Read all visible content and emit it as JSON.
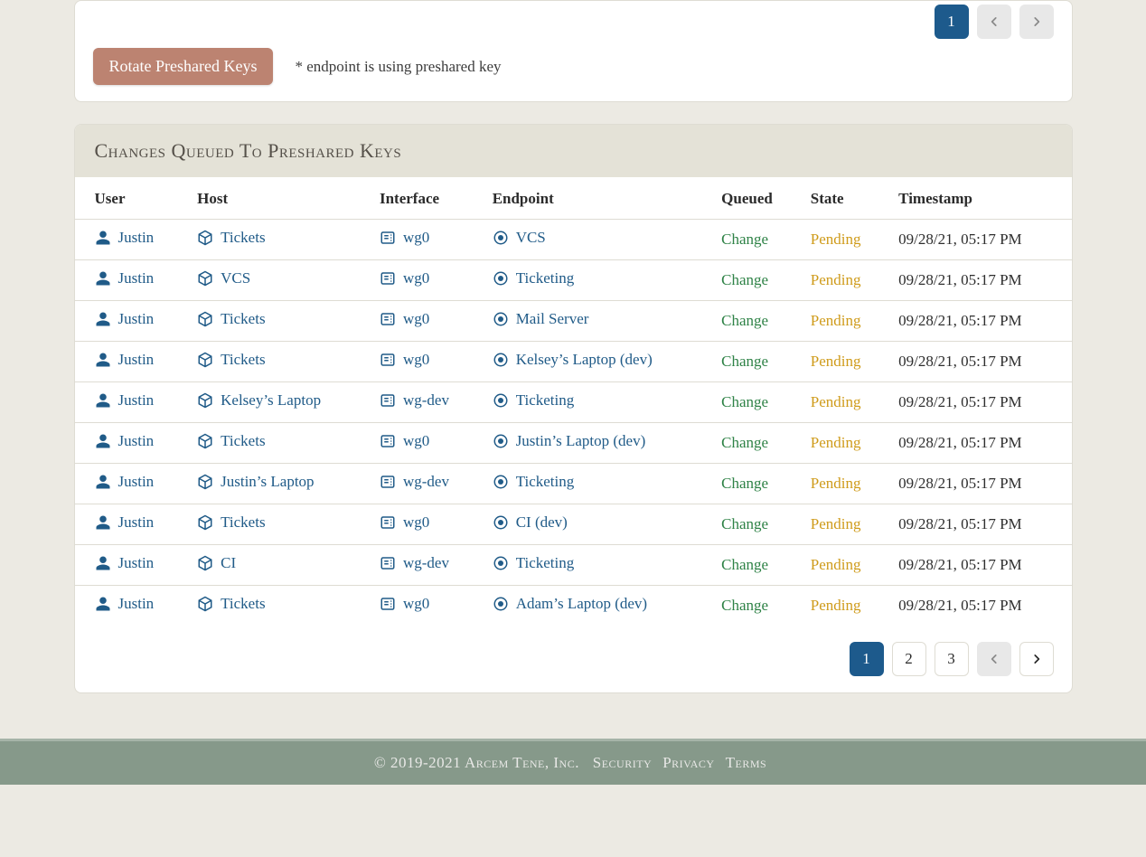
{
  "top": {
    "rotate_label": "Rotate Preshared Keys",
    "psk_note": "* endpoint is using preshared key",
    "pagination": {
      "pages": [
        "1"
      ],
      "active_index": 0,
      "prev_disabled": true,
      "next_disabled": true
    }
  },
  "changes": {
    "title": "Changes Queued To Preshared Keys",
    "columns": {
      "user": "User",
      "host": "Host",
      "interface": "Interface",
      "endpoint": "Endpoint",
      "queued": "Queued",
      "state": "State",
      "timestamp": "Timestamp"
    },
    "rows": [
      {
        "user": "Justin",
        "host": "Tickets",
        "interface": "wg0",
        "endpoint": "VCS",
        "queued": "Change",
        "state": "Pending",
        "timestamp": "09/28/21, 05:17 PM"
      },
      {
        "user": "Justin",
        "host": "VCS",
        "interface": "wg0",
        "endpoint": "Ticketing",
        "queued": "Change",
        "state": "Pending",
        "timestamp": "09/28/21, 05:17 PM"
      },
      {
        "user": "Justin",
        "host": "Tickets",
        "interface": "wg0",
        "endpoint": "Mail Server",
        "queued": "Change",
        "state": "Pending",
        "timestamp": "09/28/21, 05:17 PM"
      },
      {
        "user": "Justin",
        "host": "Tickets",
        "interface": "wg0",
        "endpoint": "Kelsey’s Laptop (dev)",
        "queued": "Change",
        "state": "Pending",
        "timestamp": "09/28/21, 05:17 PM"
      },
      {
        "user": "Justin",
        "host": "Kelsey’s Laptop",
        "interface": "wg-dev",
        "endpoint": "Ticketing",
        "queued": "Change",
        "state": "Pending",
        "timestamp": "09/28/21, 05:17 PM"
      },
      {
        "user": "Justin",
        "host": "Tickets",
        "interface": "wg0",
        "endpoint": "Justin’s Laptop (dev)",
        "queued": "Change",
        "state": "Pending",
        "timestamp": "09/28/21, 05:17 PM"
      },
      {
        "user": "Justin",
        "host": "Justin’s Laptop",
        "interface": "wg-dev",
        "endpoint": "Ticketing",
        "queued": "Change",
        "state": "Pending",
        "timestamp": "09/28/21, 05:17 PM"
      },
      {
        "user": "Justin",
        "host": "Tickets",
        "interface": "wg0",
        "endpoint": "CI (dev)",
        "queued": "Change",
        "state": "Pending",
        "timestamp": "09/28/21, 05:17 PM"
      },
      {
        "user": "Justin",
        "host": "CI",
        "interface": "wg-dev",
        "endpoint": "Ticketing",
        "queued": "Change",
        "state": "Pending",
        "timestamp": "09/28/21, 05:17 PM"
      },
      {
        "user": "Justin",
        "host": "Tickets",
        "interface": "wg0",
        "endpoint": "Adam’s Laptop (dev)",
        "queued": "Change",
        "state": "Pending",
        "timestamp": "09/28/21, 05:17 PM"
      }
    ],
    "pagination": {
      "pages": [
        "1",
        "2",
        "3"
      ],
      "active_index": 0,
      "prev_disabled": true,
      "next_disabled": false
    }
  },
  "footer": {
    "copyright": "© 2019-2021 Arcem Tene, Inc.",
    "links": [
      "Security",
      "Privacy",
      "Terms"
    ]
  }
}
